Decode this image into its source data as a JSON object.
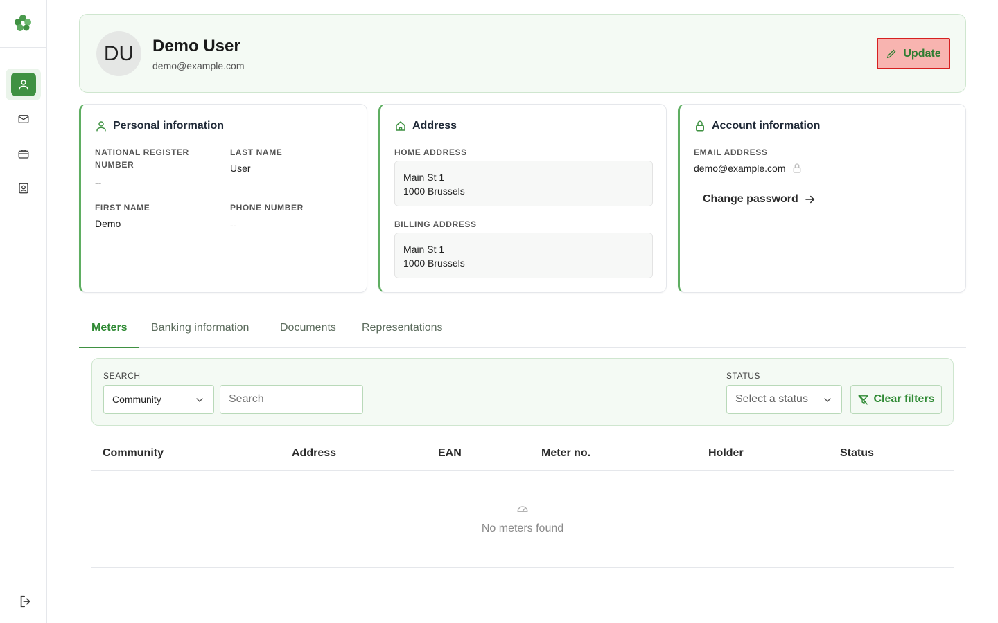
{
  "sidebar": {
    "logo": "clover-logo-icon",
    "items": [
      {
        "name": "profile",
        "icon": "user-icon",
        "active": true
      },
      {
        "name": "messages",
        "icon": "mail-icon",
        "active": false
      },
      {
        "name": "portfolio",
        "icon": "briefcase-icon",
        "active": false
      },
      {
        "name": "contacts",
        "icon": "contact-card-icon",
        "active": false
      }
    ],
    "logout_icon": "logout-icon"
  },
  "profile": {
    "initials": "DU",
    "name": "Demo User",
    "email": "demo@example.com",
    "update_label": "Update"
  },
  "personal": {
    "title": "Personal information",
    "national_register_label": "NATIONAL REGISTER NUMBER",
    "national_register_value": "--",
    "last_name_label": "LAST NAME",
    "last_name_value": "User",
    "first_name_label": "FIRST NAME",
    "first_name_value": "Demo",
    "phone_label": "PHONE NUMBER",
    "phone_value": "--"
  },
  "address": {
    "title": "Address",
    "home_label": "HOME ADDRESS",
    "home_line1": "Main St 1",
    "home_line2": "1000 Brussels",
    "billing_label": "BILLING ADDRESS",
    "billing_line1": "Main St 1",
    "billing_line2": "1000 Brussels"
  },
  "account": {
    "title": "Account information",
    "email_label": "EMAIL ADDRESS",
    "email_value": "demo@example.com",
    "change_password_label": "Change password"
  },
  "tabs": [
    {
      "label": "Meters",
      "active": true
    },
    {
      "label": "Banking information",
      "active": false
    },
    {
      "label": "Documents",
      "active": false
    },
    {
      "label": "Representations",
      "active": false
    }
  ],
  "filters": {
    "search_label": "SEARCH",
    "search_field_selected": "Community",
    "search_placeholder": "Search",
    "status_label": "STATUS",
    "status_placeholder": "Select a status",
    "clear_label": "Clear filters"
  },
  "table": {
    "columns": [
      "Community",
      "Address",
      "EAN",
      "Meter no.",
      "Holder",
      "Status"
    ],
    "empty_text": "No meters found",
    "empty_icon": "gauge-icon"
  },
  "colors": {
    "brand_green": "#3f9142",
    "panel_bg": "#f4faf4",
    "highlight_red": "#d62020"
  }
}
